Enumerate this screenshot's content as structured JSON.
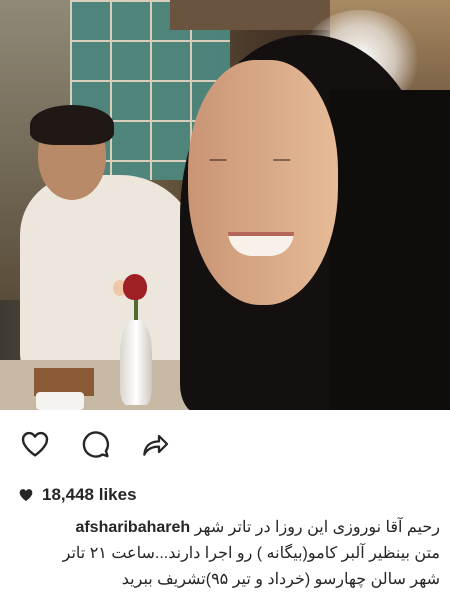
{
  "photo": {
    "icon": "post-photo"
  },
  "actions": {
    "like_icon": "heart-outline-icon",
    "comment_icon": "comment-bubble-icon",
    "share_icon": "share-arrow-icon"
  },
  "likes": {
    "icon": "heart-filled-icon",
    "text": "18,448 likes"
  },
  "caption": {
    "username": "afsharibahareh",
    "line1": "رحیم آقا نوروزی این روزا در تاتر شهر",
    "line2": "متن بینظیر آلبر کامو(بیگانه ) رو اجرا دارند...ساعت ۲۱ تاتر",
    "line3": "شهر سالن چهارسو (خرداد و تیر ۹۵)تشریف ببرید"
  },
  "colors": {
    "text": "#262626",
    "background": "#ffffff"
  }
}
